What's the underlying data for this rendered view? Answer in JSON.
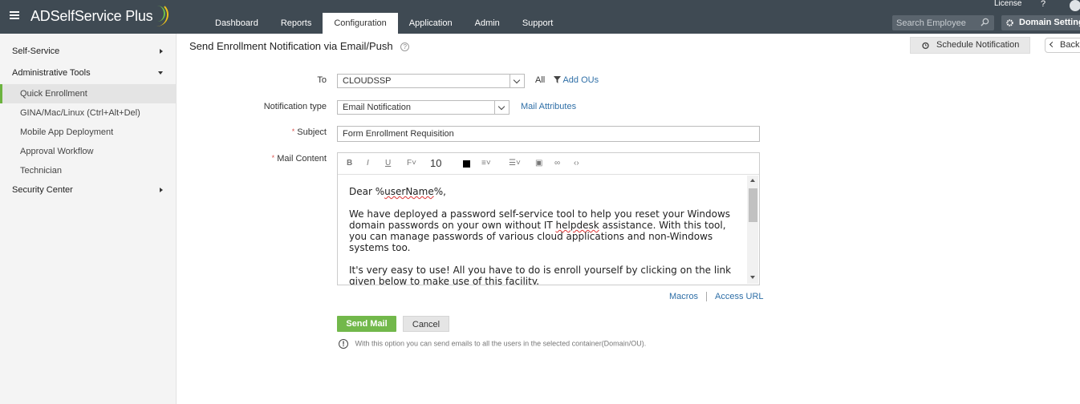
{
  "header": {
    "logo_text": "ADSelfService Plus",
    "nav_tabs": [
      "Dashboard",
      "Reports",
      "Configuration",
      "Application",
      "Admin",
      "Support"
    ],
    "active_tab": "Configuration",
    "license_label": "License",
    "help_label": "?",
    "search_placeholder": "Search Employee",
    "domain_settings_label": "Domain Settings"
  },
  "sidebar": {
    "self_service": "Self-Service",
    "admin_tools": "Administrative Tools",
    "items": [
      "Quick Enrollment",
      "GINA/Mac/Linux (Ctrl+Alt+Del)",
      "Mobile App Deployment",
      "Approval Workflow",
      "Technician"
    ],
    "active_item": "Quick Enrollment",
    "security_center": "Security Center"
  },
  "page": {
    "title": "Send Enrollment Notification via Email/Push",
    "help_icon": "?",
    "schedule_button": "Schedule Notification",
    "back_button": "Back"
  },
  "form": {
    "to_label": "To",
    "to_value": "CLOUDSSP",
    "all_label": "All",
    "add_ous": "Add OUs",
    "notification_type_label": "Notification type",
    "notification_type_value": "Email Notification",
    "mail_attributes": "Mail Attributes",
    "required_mark": "*",
    "subject_label": "Subject",
    "subject_value": "Form Enrollment Requisition",
    "mail_content_label": "Mail Content",
    "font_size": "10",
    "mail_body": {
      "greeting_prefix": "Dear %",
      "greeting_var": "userName",
      "greeting_suffix": "%,",
      "para1_a": "We have deployed a password self-service tool to help you reset your Windows domain passwords on your own without IT ",
      "para1_helpdesk": "helpdesk",
      "para1_b": " assistance. With this tool, you can manage passwords of various cloud applications and non-Windows systems too.",
      "para2": "It's very easy to use! All you have to do is enroll yourself by clicking on the link given below to make use of this facility."
    },
    "macros_link": "Macros",
    "access_url_link": "Access URL",
    "send_button": "Send Mail",
    "cancel_button": "Cancel",
    "info_text": "With this option you can send emails to all the users in the selected container(Domain/OU)."
  }
}
